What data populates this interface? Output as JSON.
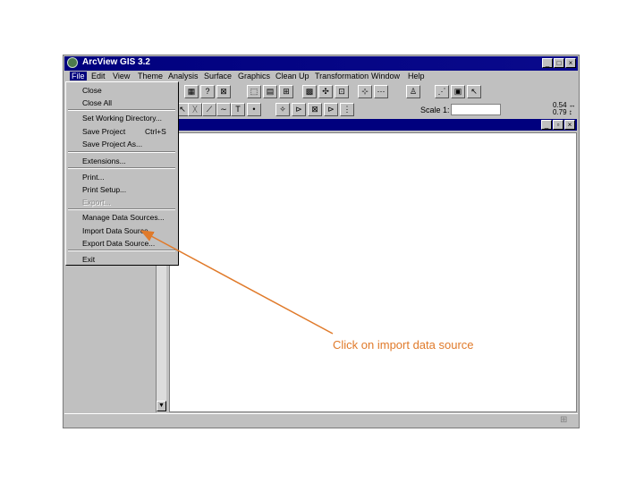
{
  "app": {
    "title": "ArcView GIS 3.2",
    "window_buttons": [
      "_",
      "□",
      "×"
    ]
  },
  "menubar": {
    "items": [
      "File",
      "Edit",
      "View",
      "Theme",
      "Analysis",
      "Surface",
      "Graphics",
      "Clean Up",
      "Transformation",
      "Window",
      "Help"
    ]
  },
  "toolbar": {
    "scale_label": "Scale 1:",
    "scale_value": "",
    "coords": [
      "0.54 ↔",
      "0.79 ↕"
    ]
  },
  "doc_window": {
    "buttons": [
      "_",
      "▫",
      "×"
    ]
  },
  "file_menu": {
    "items": [
      {
        "label": "Close",
        "enabled": true
      },
      {
        "label": "Close All",
        "enabled": true
      },
      {
        "label": "Set Working Directory...",
        "enabled": true
      },
      {
        "label": "Save Project",
        "shortcut": "Ctrl+S",
        "enabled": true
      },
      {
        "label": "Save Project As...",
        "enabled": true
      },
      {
        "label": "Extensions...",
        "enabled": true
      },
      {
        "label": "Print...",
        "enabled": true
      },
      {
        "label": "Print Setup...",
        "enabled": true
      },
      {
        "label": "Export...",
        "enabled": false
      },
      {
        "label": "Manage Data Sources...",
        "enabled": true
      },
      {
        "label": "Import Data Source...",
        "enabled": true
      },
      {
        "label": "Export Data Source...",
        "enabled": true
      },
      {
        "label": "Exit",
        "enabled": true
      }
    ]
  },
  "annotation": {
    "text": "Click on import data source",
    "color": "#e07a2a"
  },
  "colors": {
    "titlebar": "#00007e",
    "window_bg": "#c0c0c0"
  }
}
